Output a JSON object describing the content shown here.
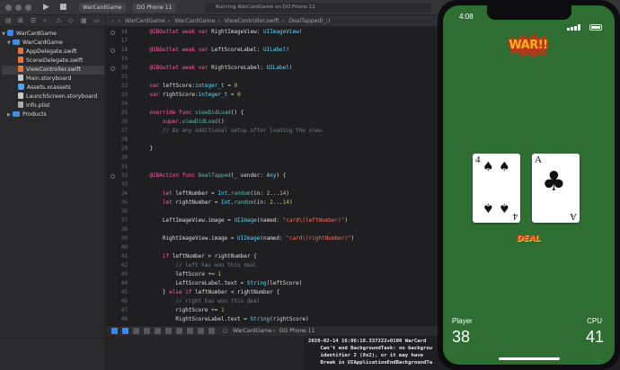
{
  "toolbar": {
    "scheme_target": "WarCardGame",
    "scheme_device": "DO Phone 11",
    "activity": "Running WarCardGame on DO Phone 11"
  },
  "navigator": {
    "items": [
      {
        "label": "WarCardGame",
        "kind": "project"
      },
      {
        "label": "WarCardGame",
        "kind": "folder"
      },
      {
        "label": "AppDelegate.swift",
        "kind": "swift"
      },
      {
        "label": "SceneDelegate.swift",
        "kind": "swift"
      },
      {
        "label": "ViewController.swift",
        "kind": "swift",
        "selected": true
      },
      {
        "label": "Main.storyboard",
        "kind": "storyboard"
      },
      {
        "label": "Assets.xcassets",
        "kind": "assets"
      },
      {
        "label": "LaunchScreen.storyboard",
        "kind": "storyboard"
      },
      {
        "label": "Info.plist",
        "kind": "plist"
      },
      {
        "label": "Products",
        "kind": "folder"
      }
    ]
  },
  "jumpbar": {
    "crumbs": [
      "WarCardGame",
      "WarCardGame",
      "ViewController.swift",
      "DealTapped(_:)"
    ]
  },
  "editor": {
    "lines": [
      {
        "n": "16",
        "code": "    @IBOutlet weak var RightImageView: UIImageView!"
      },
      {
        "n": "17",
        "code": ""
      },
      {
        "n": "18",
        "code": "    @IBOutlet weak var LeftScoreLabel: UILabel!"
      },
      {
        "n": "19",
        "code": ""
      },
      {
        "n": "20",
        "code": "    @IBOutlet weak var RightScoreLabel: UILabel!"
      },
      {
        "n": "21",
        "code": ""
      },
      {
        "n": "22",
        "code": "    var leftScore:integer_t = 0"
      },
      {
        "n": "23",
        "code": "    var rightScore:integer_t = 0"
      },
      {
        "n": "24",
        "code": ""
      },
      {
        "n": "25",
        "code": "    override func viewDidLoad() {"
      },
      {
        "n": "26",
        "code": "        super.viewDidLoad()"
      },
      {
        "n": "27",
        "code": "        // Do any additional setup after loading the view."
      },
      {
        "n": "28",
        "code": ""
      },
      {
        "n": "29",
        "code": "    }"
      },
      {
        "n": "30",
        "code": ""
      },
      {
        "n": "31",
        "code": ""
      },
      {
        "n": "32",
        "code": "    @IBAction func DealTapped(_ sender: Any) {"
      },
      {
        "n": "33",
        "code": ""
      },
      {
        "n": "34",
        "code": "        let leftNumber = Int.random(in: 2...14)"
      },
      {
        "n": "35",
        "code": "        let rightNumber = Int.random(in: 2...14)"
      },
      {
        "n": "36",
        "code": ""
      },
      {
        "n": "37",
        "code": "        LeftImageView.image = UIImage(named: \"card\\(leftNumber)\")"
      },
      {
        "n": "38",
        "code": ""
      },
      {
        "n": "39",
        "code": "        RightImageView.image = UIImage(named: \"card\\(rightNumber)\")"
      },
      {
        "n": "40",
        "code": ""
      },
      {
        "n": "41",
        "code": "        if leftNumber > rightNumber {"
      },
      {
        "n": "42",
        "code": "            // left has won this deal"
      },
      {
        "n": "43",
        "code": "            leftScore += 1"
      },
      {
        "n": "44",
        "code": "            LeftScoreLabel.text = String(leftScore)"
      },
      {
        "n": "45",
        "code": "        } else if leftNumber < rightNumber {"
      },
      {
        "n": "46",
        "code": "            // right has won this deal"
      },
      {
        "n": "47",
        "code": "            rightScore += 1"
      },
      {
        "n": "48",
        "code": "            RightScoreLabel.text = String(rightScore)"
      },
      {
        "n": "49",
        "code": "        } else if leftNumber == rightNumber {"
      },
      {
        "n": "50",
        "code": "            // tie"
      },
      {
        "n": "51",
        "code": "        }",
        "current": true
      },
      {
        "n": "52",
        "code": ""
      },
      {
        "n": "53",
        "code": "    }"
      },
      {
        "n": "54",
        "code": ""
      }
    ]
  },
  "debugbar": {
    "target": "WarCardGame",
    "device": "DO Phone 11"
  },
  "console": {
    "lines": [
      "2020-02-14 16:06:18.337222+0100 WarCard",
      "    Can't end BackgroundTask: no backgrou",
      "    identifier 2 (0x2), or it may have",
      "    Break in UIApplicationEndBackgroundTa"
    ]
  },
  "simulator": {
    "time": "4:08",
    "logo_text": "WAR!!",
    "left_card": {
      "rank": "4",
      "suit": "♠"
    },
    "right_card": {
      "rank": "A",
      "suit": "♣"
    },
    "deal_label": "DEAL",
    "player_label": "Player",
    "player_score": "38",
    "cpu_label": "CPU",
    "cpu_score": "41"
  },
  "colors": {
    "table_green": "#2e6e33",
    "editor_bg": "#1f1f22",
    "keyword": "#fc5fa3",
    "type": "#5dd8ff",
    "comment": "#6c7986",
    "string": "#fc6a5d"
  }
}
